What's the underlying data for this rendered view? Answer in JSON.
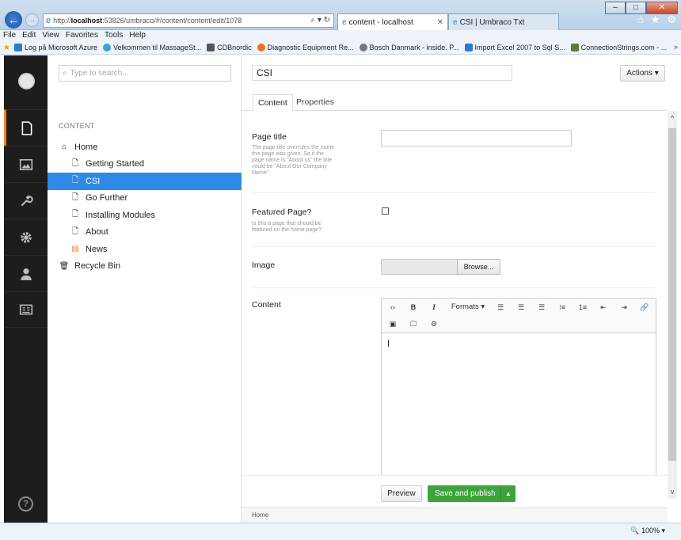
{
  "browser": {
    "address_host": "localhost",
    "address_prefix": "http://",
    "address_path": ":53826/umbraco/#/content/content/edit/1078",
    "address_tools": "⌕ ▾ ↻",
    "tabs": [
      {
        "label": "content - localhost"
      },
      {
        "label": "CSI | Umbraco Txt"
      }
    ],
    "menu": [
      "File",
      "Edit",
      "View",
      "Favorites",
      "Tools",
      "Help"
    ],
    "favorites": [
      {
        "label": "Log på Microsoft Azure",
        "color": "#2a7bd0"
      },
      {
        "label": "Velkommen til MassageSt...",
        "color": "#3f9fd8"
      },
      {
        "label": "CDBnordic",
        "color": "#555555"
      },
      {
        "label": "Diagnostic Equipment Re...",
        "color": "#e8731e"
      },
      {
        "label": "Bosch Danmark - inside. P...",
        "color": "#777777"
      },
      {
        "label": "Import Excel 2007 to Sql S...",
        "color": "#2a7bd0"
      },
      {
        "label": "ConnectionStrings.com - ...",
        "color": "#5a7a3a"
      }
    ],
    "zoom": "100%"
  },
  "search": {
    "placeholder": "Type to search..."
  },
  "tree": {
    "header": "CONTENT",
    "items": [
      {
        "label": "Home",
        "icon": "home-icon",
        "indent": 0
      },
      {
        "label": "Getting Started",
        "icon": "document-icon",
        "indent": 1
      },
      {
        "label": "CSI",
        "icon": "document-icon",
        "indent": 1,
        "selected": true
      },
      {
        "label": "Go Further",
        "icon": "document-icon",
        "indent": 1
      },
      {
        "label": "Installing Modules",
        "icon": "document-icon",
        "indent": 1
      },
      {
        "label": "About",
        "icon": "document-icon",
        "indent": 1
      },
      {
        "label": "News",
        "icon": "newspaper-icon",
        "indent": 1
      },
      {
        "label": "Recycle Bin",
        "icon": "trash-icon",
        "indent": 0
      }
    ]
  },
  "editor": {
    "node_name": "CSI",
    "actions_label": "Actions ▾",
    "tabs": [
      "Content",
      "Properties"
    ],
    "props": {
      "page_title_label": "Page title",
      "page_title_desc": "The page title overrules the name this page was given. So if the page name is \"About us\" the title could be \"About Our Company Name\".",
      "featured_label": "Featured Page?",
      "featured_desc": "Is this a page that should be featured on the home page?",
      "image_label": "Image",
      "browse_label": "Browse...",
      "content_label": "Content",
      "formats_label": "Formats ▾"
    },
    "preview_label": "Preview",
    "publish_label": "Save and publish",
    "breadcrumb": "Home"
  },
  "colors": {
    "accent": "#f5821f",
    "selected": "#2e8ae6",
    "publish": "#3ba53b"
  }
}
